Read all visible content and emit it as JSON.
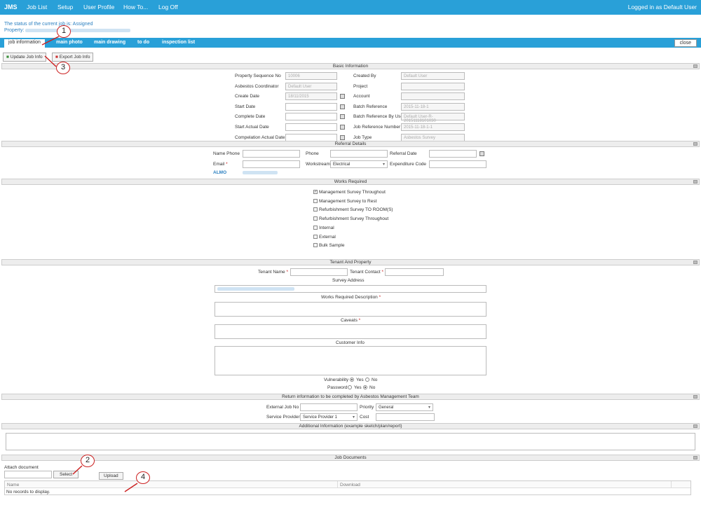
{
  "topnav": {
    "brand": "JMS",
    "items": [
      "Job List",
      "Setup",
      "User Profile",
      "How To...",
      "Log Off"
    ],
    "login": "Logged in as Default User"
  },
  "status": {
    "text": "The status of the current job is: Assigned",
    "property_label": "Property:"
  },
  "tabs": [
    "job information",
    "main photo",
    "main drawing",
    "to do",
    "inspection list"
  ],
  "close_label": "close",
  "toolbar": {
    "update": "Update Job Info",
    "export": "Export Job Info"
  },
  "sections": {
    "basic": "Basic Information",
    "referral": "Referral Details",
    "works": "Works Required",
    "tenant": "Tenant And Property",
    "return": "Return information to be completed by Asbestos Management Team",
    "additional": "Additional Information (example sketch/plan/report)",
    "documents": "Job Documents"
  },
  "basic": {
    "left": [
      {
        "label": "Property Sequence No",
        "value": "10006"
      },
      {
        "label": "Asbestos Coordinator",
        "value": "Default User"
      },
      {
        "label": "Create Date",
        "value": "18/11/2015"
      },
      {
        "label": "Start Date",
        "value": ""
      },
      {
        "label": "Complete Date",
        "value": ""
      },
      {
        "label": "Start Actual Date",
        "value": ""
      },
      {
        "label": "Compelation Actual Date",
        "value": ""
      }
    ],
    "right": [
      {
        "label": "Created By",
        "value": "Default User"
      },
      {
        "label": "Project",
        "value": ""
      },
      {
        "label": "Account",
        "value": ""
      },
      {
        "label": "Batch Reference",
        "value": "2015-11-18-1"
      },
      {
        "label": "Batch Reference By User",
        "value": "Default User-R-20151118101030"
      },
      {
        "label": "Job Reference Number",
        "value": "2015-11-18-1-1"
      },
      {
        "label": "Job Type",
        "value": "Asbestos Survey"
      }
    ]
  },
  "referral": {
    "name_phone": "Name Phone",
    "phone": "Phone",
    "referral_date": "Referral Date",
    "email": "Email",
    "workstream": "Workstream",
    "workstream_value": "Electrical",
    "expenditure": "Expenditure Code",
    "almo": "ALMO"
  },
  "works": [
    {
      "label": "Management Survey Throughout",
      "checked": true
    },
    {
      "label": "Management Survey to Rest",
      "checked": false
    },
    {
      "label": "Refurbishment Survey TO ROOM(S)",
      "checked": false
    },
    {
      "label": "Refurbishment Survey Throughout",
      "checked": false
    },
    {
      "label": "Internal",
      "checked": false
    },
    {
      "label": "External",
      "checked": false
    },
    {
      "label": "Bulk Sample",
      "checked": false
    }
  ],
  "tenant": {
    "name": "Tenant Name",
    "contact": "Tenant Contact",
    "survey_address": "Survey Address",
    "works_desc": "Works Required Description",
    "caveats": "Caveats",
    "customer_info": "Customer Info",
    "vulnerability": "Vulnerability",
    "password": "Password",
    "yes": "Yes",
    "no": "No",
    "required": "*"
  },
  "return_info": {
    "external_job": "External Job No",
    "priority": "Priority",
    "priority_value": "General",
    "service_provider": "Service Provider",
    "service_provider_value": "Service Provider 1",
    "cost": "Cost"
  },
  "documents": {
    "attach": "Attach document",
    "select": "Select",
    "upload": "Upload",
    "col_name": "Name",
    "col_download": "Download",
    "empty": "No records to display."
  },
  "callouts": [
    "1",
    "2",
    "3",
    "4"
  ],
  "colors": {
    "accent": "#29a0d8",
    "link": "#2a7fc0",
    "callout": "#cc2222"
  }
}
